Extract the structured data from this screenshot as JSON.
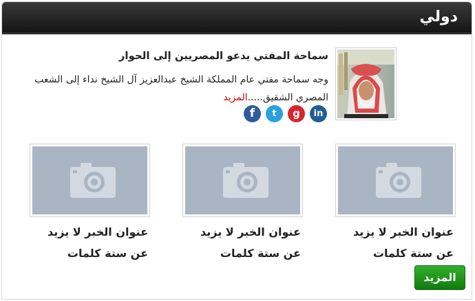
{
  "widget": {
    "title": "دولي"
  },
  "featured": {
    "title": "سماحة المفتي يدعو المصريين إلى الحوار",
    "excerpt": "وجه سماحة مفتي عام المملكة الشيخ عبدالعزيز آل الشيخ نداء إلى الشعب المصري الشقيق.....",
    "more_link": "المزيد",
    "thumbnail_icon": "portrait-photo"
  },
  "share": {
    "facebook": "f",
    "twitter": "t",
    "google_plus": "g",
    "linkedin": "in"
  },
  "cards": [
    {
      "title": "عنوان الخبر لا يزيد عن ستة كلمات",
      "icon": "camera-icon"
    },
    {
      "title": "عنوان الخبر لا يزيد عن ستة كلمات",
      "icon": "camera-icon"
    },
    {
      "title": "عنوان الخبر لا يزيد عن ستة كلمات",
      "icon": "camera-icon"
    }
  ],
  "more_button": "المزيد",
  "colors": {
    "header_dark": "#1a1a1a",
    "more_link": "#d40000",
    "button_green": "#1e8f19",
    "placeholder": "#a9b5c3"
  }
}
